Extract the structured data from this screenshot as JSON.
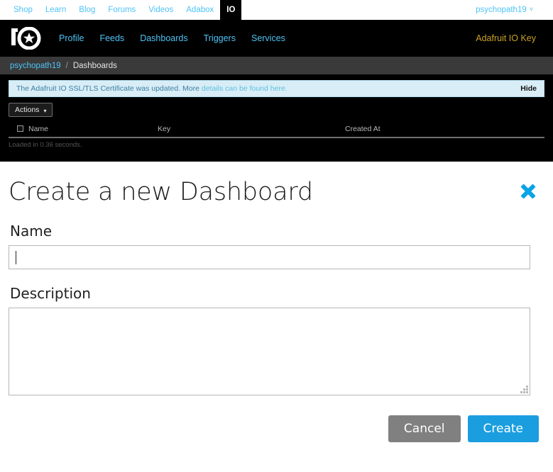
{
  "top_bar": {
    "links": [
      {
        "label": "Shop",
        "active": false
      },
      {
        "label": "Learn",
        "active": false
      },
      {
        "label": "Blog",
        "active": false
      },
      {
        "label": "Forums",
        "active": false
      },
      {
        "label": "Videos",
        "active": false
      },
      {
        "label": "Adabox",
        "active": false
      },
      {
        "label": "IO",
        "active": true
      }
    ],
    "user": "psychopath19",
    "user_caret": "˅"
  },
  "io_nav": {
    "logo_name": "adafruit-io-logo",
    "links": [
      {
        "label": "Profile"
      },
      {
        "label": "Feeds"
      },
      {
        "label": "Dashboards"
      },
      {
        "label": "Triggers"
      },
      {
        "label": "Services"
      }
    ],
    "io_key_label": "Adafruit IO Key",
    "io_key_color": "#c9a227"
  },
  "breadcrumb": {
    "root": "psychopath19",
    "separator": "/",
    "current": "Dashboards"
  },
  "alert": {
    "text_before": "The Adafruit IO SSL/TLS Certificate was updated. More ",
    "link_text": "details can be found here.",
    "hide_label": "Hide",
    "bg_color": "#d9edf7"
  },
  "toolbar": {
    "actions_label": "Actions",
    "actions_caret": "▾"
  },
  "table": {
    "columns": [
      "Name",
      "Key",
      "Created At"
    ],
    "rows": [],
    "loaded_note": "Loaded in 0.36 seconds."
  },
  "modal": {
    "title": "Create a new Dashboard",
    "close_icon": "close-x-icon",
    "close_color": "#0aa3e8",
    "name": {
      "label": "Name",
      "value": "",
      "placeholder": ""
    },
    "description": {
      "label": "Description",
      "value": "",
      "placeholder": ""
    },
    "buttons": {
      "cancel_label": "Cancel",
      "cancel_color": "#808080",
      "create_label": "Create",
      "create_color": "#1a9ee0"
    }
  }
}
